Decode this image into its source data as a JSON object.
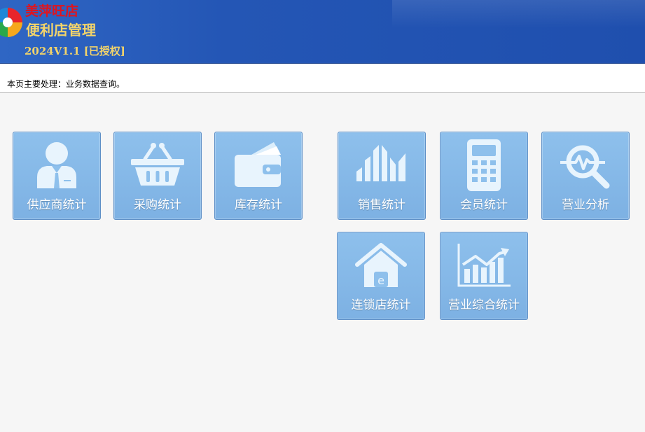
{
  "header": {
    "brand_name": "美萍旺店",
    "app_title": "便利店管理",
    "version": "2024V1.1 [已授权]"
  },
  "notice": {
    "text": "本页主要处理：业务数据查询。"
  },
  "tiles": [
    {
      "label": "供应商统计",
      "icon": "supplier-person-icon"
    },
    {
      "label": "采购统计",
      "icon": "shopping-basket-icon"
    },
    {
      "label": "库存统计",
      "icon": "wallet-icon"
    },
    {
      "label": "销售统计",
      "icon": "bar-chart-icon"
    },
    {
      "label": "会员统计",
      "icon": "calculator-icon"
    },
    {
      "label": "营业分析",
      "icon": "magnifier-pulse-icon"
    },
    {
      "label": "连锁店统计",
      "icon": "house-icon"
    },
    {
      "label": "营业综合统计",
      "icon": "trend-chart-icon"
    }
  ],
  "colors": {
    "header_bg": "#2456b5",
    "brand_red": "#e0141e",
    "title_gold": "#f3d46a",
    "tile_bg": "#8ec0ec",
    "page_bg": "#f6f6f6"
  }
}
